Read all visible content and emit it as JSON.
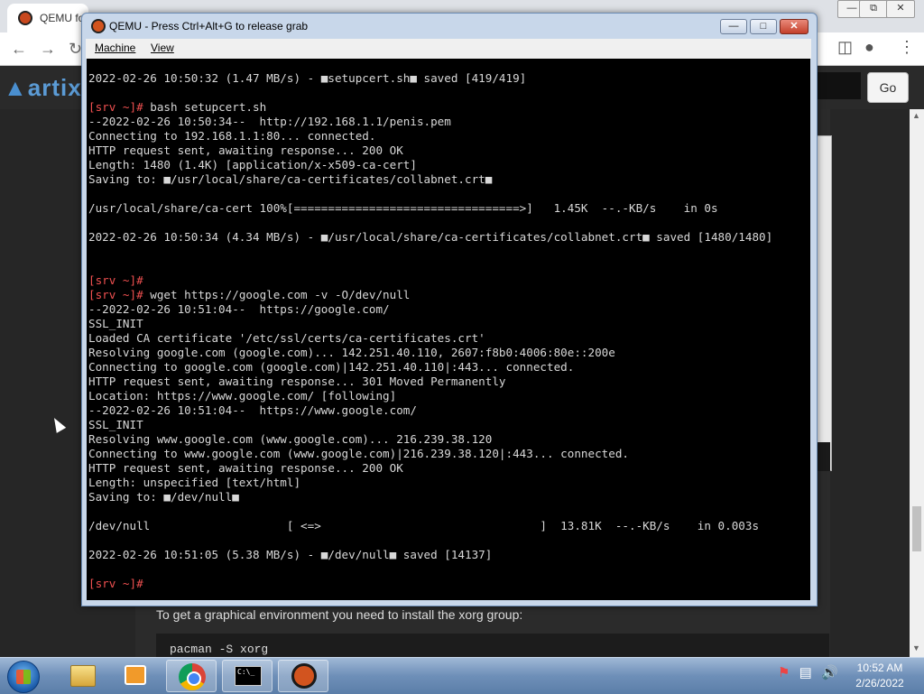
{
  "browser": {
    "tab_title": "QEMU fo",
    "go_label": "Go",
    "window_controls": [
      "—",
      "⧉",
      "✕"
    ]
  },
  "site": {
    "logo_text": "artix",
    "body_text": "To get a graphical environment you need to install the xorg group:",
    "code_text": "pacman -S xorg"
  },
  "qemu": {
    "title": "QEMU - Press Ctrl+Alt+G to release grab",
    "menu": [
      "Machine",
      "View"
    ],
    "controls": {
      "minimize": "—",
      "maximize": "□",
      "close": "✕"
    }
  },
  "terminal": {
    "lines": [
      {
        "p": "",
        "t": "2022-02-26 10:50:32 (1.47 MB/s) - ■setupcert.sh■ saved [419/419]"
      },
      {
        "p": "",
        "t": ""
      },
      {
        "p": "[srv ~]#",
        "t": " bash setupcert.sh"
      },
      {
        "p": "",
        "t": "--2022-02-26 10:50:34--  http://192.168.1.1/penis.pem"
      },
      {
        "p": "",
        "t": "Connecting to 192.168.1.1:80... connected."
      },
      {
        "p": "",
        "t": "HTTP request sent, awaiting response... 200 OK"
      },
      {
        "p": "",
        "t": "Length: 1480 (1.4K) [application/x-x509-ca-cert]"
      },
      {
        "p": "",
        "t": "Saving to: ■/usr/local/share/ca-certificates/collabnet.crt■"
      },
      {
        "p": "",
        "t": ""
      },
      {
        "p": "",
        "t": "/usr/local/share/ca-cert 100%[=================================>]   1.45K  --.-KB/s    in 0s"
      },
      {
        "p": "",
        "t": ""
      },
      {
        "p": "",
        "t": "2022-02-26 10:50:34 (4.34 MB/s) - ■/usr/local/share/ca-certificates/collabnet.crt■ saved [1480/1480]"
      },
      {
        "p": "",
        "t": ""
      },
      {
        "p": "",
        "t": ""
      },
      {
        "p": "[srv ~]#",
        "t": ""
      },
      {
        "p": "[srv ~]#",
        "t": " wget https://google.com -v -O/dev/null"
      },
      {
        "p": "",
        "t": "--2022-02-26 10:51:04--  https://google.com/"
      },
      {
        "p": "",
        "t": "SSL_INIT"
      },
      {
        "p": "",
        "t": "Loaded CA certificate '/etc/ssl/certs/ca-certificates.crt'"
      },
      {
        "p": "",
        "t": "Resolving google.com (google.com)... 142.251.40.110, 2607:f8b0:4006:80e::200e"
      },
      {
        "p": "",
        "t": "Connecting to google.com (google.com)|142.251.40.110|:443... connected."
      },
      {
        "p": "",
        "t": "HTTP request sent, awaiting response... 301 Moved Permanently"
      },
      {
        "p": "",
        "t": "Location: https://www.google.com/ [following]"
      },
      {
        "p": "",
        "t": "--2022-02-26 10:51:04--  https://www.google.com/"
      },
      {
        "p": "",
        "t": "SSL_INIT"
      },
      {
        "p": "",
        "t": "Resolving www.google.com (www.google.com)... 216.239.38.120"
      },
      {
        "p": "",
        "t": "Connecting to www.google.com (www.google.com)|216.239.38.120|:443... connected."
      },
      {
        "p": "",
        "t": "HTTP request sent, awaiting response... 200 OK"
      },
      {
        "p": "",
        "t": "Length: unspecified [text/html]"
      },
      {
        "p": "",
        "t": "Saving to: ■/dev/null■"
      },
      {
        "p": "",
        "t": ""
      },
      {
        "p": "",
        "t": "/dev/null                    [ <=>                                ]  13.81K  --.-KB/s    in 0.003s"
      },
      {
        "p": "",
        "t": ""
      },
      {
        "p": "",
        "t": "2022-02-26 10:51:05 (5.38 MB/s) - ■/dev/null■ saved [14137]"
      },
      {
        "p": "",
        "t": ""
      },
      {
        "p": "[srv ~]#",
        "t": ""
      }
    ]
  },
  "taskbar": {
    "time": "10:52 AM",
    "date": "2/26/2022",
    "apps": [
      "windows-explorer",
      "media-player",
      "google-chrome",
      "command-prompt",
      "qemu"
    ],
    "cmd_icon_text": "C:\\_"
  }
}
